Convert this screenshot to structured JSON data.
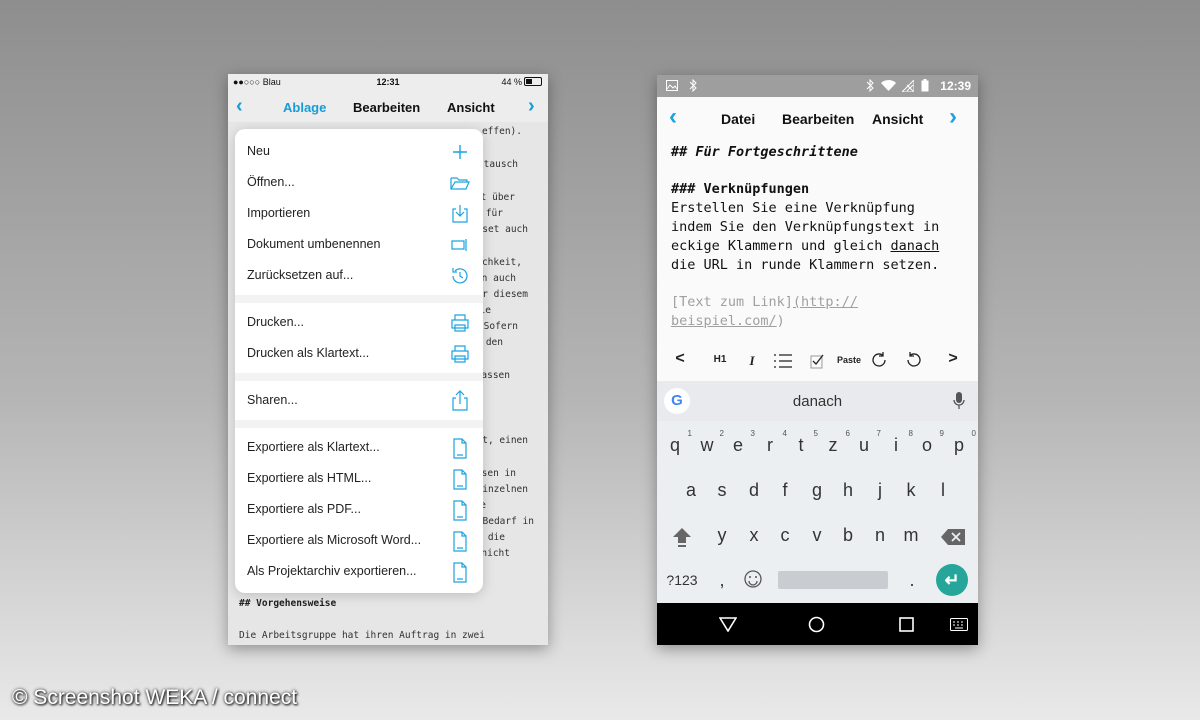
{
  "ios": {
    "status": {
      "carrier": "Blau",
      "time": "12:31",
      "battery": "44 %"
    },
    "nav": {
      "items": [
        "Ablage",
        "Bearbeiten",
        "Ansicht"
      ]
    },
    "editor_fragments": [
      "effen).",
      "tausch",
      "t über",
      "für",
      "set auch",
      "chkeit,",
      "n auch",
      "r diesem",
      "ie",
      "Sofern",
      "den",
      "assen",
      "t, einen",
      "sen in",
      "inzelnen",
      "e",
      "Bedarf in",
      "die",
      "nicht"
    ],
    "editor_heading": "## Vorgehensweise",
    "editor_last": "Die Arbeitsgruppe hat ihren Auftrag in zwei",
    "menu": [
      {
        "label": "Neu",
        "icon": "plus-icon"
      },
      {
        "label": "Öffnen...",
        "icon": "folder-open-icon"
      },
      {
        "label": "Importieren",
        "icon": "import-icon"
      },
      {
        "label": "Dokument umbenennen",
        "icon": "rename-icon"
      },
      {
        "label": "Zurücksetzen auf...",
        "icon": "history-icon"
      },
      {
        "label": "Drucken...",
        "icon": "printer-icon"
      },
      {
        "label": "Drucken als Klartext...",
        "icon": "printer-icon"
      },
      {
        "label": "Sharen...",
        "icon": "share-icon"
      },
      {
        "label": "Exportiere als Klartext...",
        "icon": "document-icon"
      },
      {
        "label": "Exportiere als HTML...",
        "icon": "document-icon"
      },
      {
        "label": "Exportiere als PDF...",
        "icon": "document-icon"
      },
      {
        "label": "Exportiere als Microsoft Word...",
        "icon": "document-icon"
      },
      {
        "label": "Als Projektarchiv exportieren...",
        "icon": "document-icon"
      }
    ]
  },
  "android": {
    "status": {
      "time": "12:39"
    },
    "nav": {
      "items": [
        "Datei",
        "Bearbeiten",
        "Ansicht"
      ]
    },
    "editor": {
      "line1": "## Für Fortgeschrittene",
      "line2": "### Verknüpfungen",
      "line3": "Erstellen Sie eine Verknüpfung",
      "line4": "indem Sie den Verknüpfungstext in",
      "line5a": "eckige Klammern und gleich ",
      "line5b": "danach",
      "line6": "die URL in runde Klammern setzen.",
      "link_text": "[Text zum Link]",
      "link_url_1": "(http://",
      "link_url_2": "beispiel.com/",
      "link_url_3": ")"
    },
    "toolbar": {
      "h1": "H1",
      "italic": "I",
      "paste": "Paste",
      "prev": "<",
      "next": ">"
    },
    "keyboard": {
      "suggestion": "danach",
      "row1": [
        "q",
        "w",
        "e",
        "r",
        "t",
        "z",
        "u",
        "i",
        "o",
        "p"
      ],
      "row1_nums": [
        "1",
        "2",
        "3",
        "4",
        "5",
        "6",
        "7",
        "8",
        "9",
        "0"
      ],
      "row2": [
        "a",
        "s",
        "d",
        "f",
        "g",
        "h",
        "j",
        "k",
        "l"
      ],
      "row3": [
        "y",
        "x",
        "c",
        "v",
        "b",
        "n",
        "m"
      ],
      "symbols": "?123",
      "comma": ",",
      "period": "."
    }
  },
  "watermark": "© Screenshot WEKA / connect"
}
